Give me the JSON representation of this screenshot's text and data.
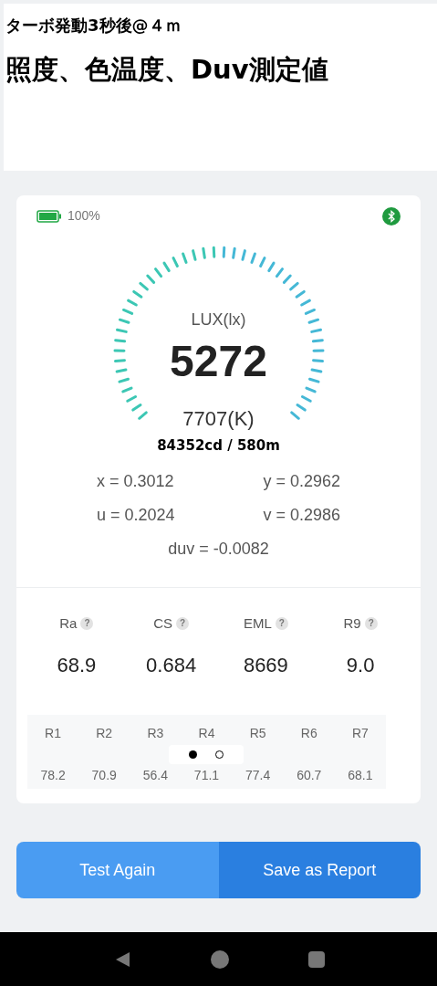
{
  "header": {
    "subtitle": "ターボ発動3秒後@４ｍ",
    "title": "照度、色温度、Duv測定値"
  },
  "status": {
    "battery": "100%",
    "bluetooth_on": true
  },
  "gauge": {
    "label": "LUX(lx)",
    "value": "5272",
    "cct": "7707(K)"
  },
  "intensity": "84352cd / 580m",
  "coords": [
    "x = 0.3012",
    "y = 0.2962",
    "u = 0.2024",
    "v = 0.2986"
  ],
  "duv": "duv = -0.0082",
  "metrics": [
    {
      "label": "Ra",
      "help": "?",
      "value": "68.9"
    },
    {
      "label": "CS",
      "help": "?",
      "value": "0.684"
    },
    {
      "label": "EML",
      "help": "?",
      "value": "8669"
    },
    {
      "label": "R9",
      "help": "?",
      "value": "9.0"
    }
  ],
  "cri_table": {
    "columns": [
      "R1",
      "R2",
      "R3",
      "R4",
      "R5",
      "R6",
      "R7"
    ],
    "values": [
      "78.2",
      "70.9",
      "56.4",
      "71.1",
      "77.4",
      "60.7",
      "68.1"
    ]
  },
  "pages": [
    {
      "selected": true
    },
    {
      "selected": false
    }
  ],
  "buttons": [
    {
      "label": "Test Again",
      "kind": "secondary"
    },
    {
      "label": "Save as Report",
      "kind": "primary"
    }
  ]
}
